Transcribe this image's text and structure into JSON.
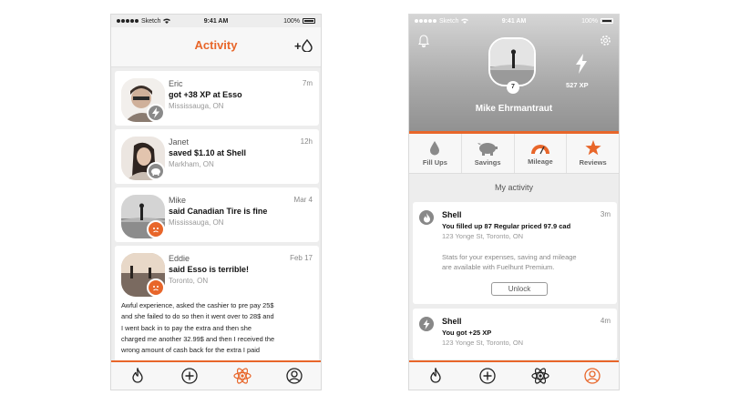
{
  "status": {
    "carrier": "Sketch",
    "time": "9:41 AM",
    "battery": "100%"
  },
  "activity_screen": {
    "title": "Activity",
    "add_label": "+",
    "cards": [
      {
        "name": "Eric",
        "time": "7m",
        "action": "got +38 XP at Esso",
        "location": "Mississauga, ON",
        "badge": "bolt",
        "badge_color": "#8a8a8a"
      },
      {
        "name": "Janet",
        "time": "12h",
        "action": "saved $1.10 at Shell",
        "location": "Markham, ON",
        "badge": "piggy",
        "badge_color": "#8a8a8a"
      },
      {
        "name": "Mike",
        "time": "Mar 4",
        "action": "said Canadian Tire is fine",
        "location": "Mississauga, ON",
        "badge": "face",
        "badge_color": "#e8662a"
      },
      {
        "name": "Eddie",
        "time": "Feb 17",
        "action": "said Esso is terrible!",
        "location": "Toronto, ON",
        "badge": "face",
        "badge_color": "#e8662a",
        "body": [
          "Awful experience, asked the cashier to pre pay 25$",
          "and she failed to do so then it went over to 28$ and",
          "I went back in to pay the extra and then she",
          "charged me another 32.99$ and then I received the",
          "wrong amount of cash back for the extra I paid"
        ]
      }
    ]
  },
  "profile_screen": {
    "user_name": "Mike Ehrmantraut",
    "level": "7",
    "xp": "527 XP",
    "stats": [
      "Fill Ups",
      "Savings",
      "Mileage",
      "Reviews"
    ],
    "section_title": "My activity",
    "activities": [
      {
        "station": "Shell",
        "time": "3m",
        "message": "You filled up 87 Regular priced 97.9 cad",
        "address": "123 Yonge St, Toronto, ON",
        "promo": [
          "Stats for your expenses, saving and mileage",
          "are available with Fuelhunt Premium."
        ],
        "button": "Unlock",
        "icon": "flame"
      },
      {
        "station": "Shell",
        "time": "4m",
        "message": "You got +25 XP",
        "address": "123 Yonge St, Toronto, ON",
        "icon": "bolt"
      }
    ]
  },
  "tabbar": {
    "tabs": [
      "flame-tab",
      "add-tab",
      "atom-tab",
      "profile-tab"
    ]
  },
  "colors": {
    "accent": "#e8662a",
    "background": "#ededed",
    "card": "#ffffff"
  }
}
